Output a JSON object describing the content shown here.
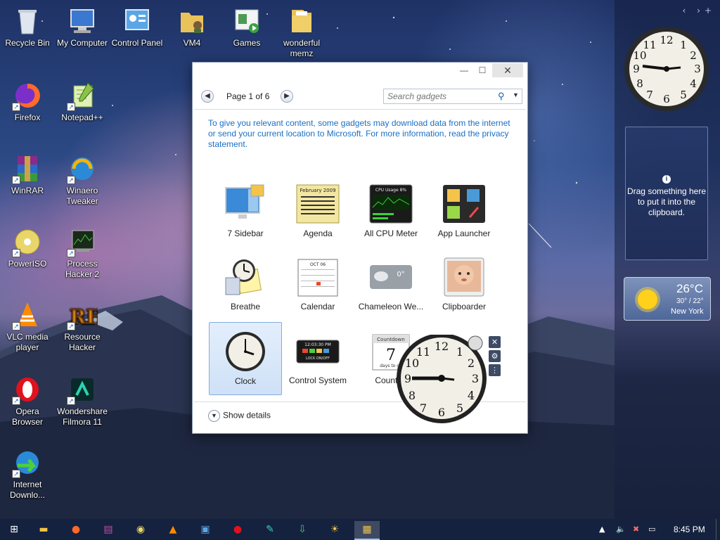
{
  "desktop": {
    "icons": [
      {
        "label": "Recycle Bin"
      },
      {
        "label": "My Computer"
      },
      {
        "label": "Control Panel"
      },
      {
        "label": "VM4"
      },
      {
        "label": "Games"
      },
      {
        "label": "wonderful memz"
      },
      {
        "label": "Firefox"
      },
      {
        "label": "Notepad++"
      },
      {
        "label": "WinRAR"
      },
      {
        "label": "Winaero Tweaker"
      },
      {
        "label": "PowerISO"
      },
      {
        "label": "Process Hacker 2"
      },
      {
        "label": "VLC media player"
      },
      {
        "label": "Resource Hacker"
      },
      {
        "label": "Opera Browser"
      },
      {
        "label": "Wondershare Filmora 11"
      },
      {
        "label": "Internet Downlo..."
      }
    ]
  },
  "gallery": {
    "page_text": "Page 1 of 6",
    "search_placeholder": "Search gadgets",
    "privacy_text": "To give you relevant content, some gadgets may download data from the internet or send your current location to Microsoft. For more information, read the privacy statement.",
    "gadgets": [
      {
        "label": "7 Sidebar"
      },
      {
        "label": "Agenda"
      },
      {
        "label": "All CPU Meter"
      },
      {
        "label": "App Launcher"
      },
      {
        "label": "Breathe"
      },
      {
        "label": "Calendar"
      },
      {
        "label": "Chameleon We..."
      },
      {
        "label": "Clipboarder"
      },
      {
        "label": "Clock"
      },
      {
        "label": "Control System"
      },
      {
        "label": "Countdo"
      }
    ],
    "selected_gadget": "Clock",
    "show_details_label": "Show details",
    "agenda_thumb_text": "February 2009",
    "cpu_thumb_text": "CPU Usage  8%",
    "control_thumb_time": "12:03:30 PM",
    "control_thumb_lock": "LOCK ON/OFF",
    "countdown_thumb_title": "Countdown",
    "countdown_thumb_num": "7",
    "countdown_thumb_sub": "days to go",
    "chameleon_thumb_temp": "0°",
    "calendar_thumb_month": "OCT 06"
  },
  "sidebar": {
    "clipboard_text": "Drag something here to put it into the clipboard.",
    "weather": {
      "temp": "26°C",
      "range": "30° / 22°",
      "city": "New York"
    }
  },
  "taskbar": {
    "time": "8:45 PM"
  },
  "colors": {
    "taskbar": "#15223f",
    "link_blue": "#1a6fc4",
    "selected_tile": "#cfe1f7"
  }
}
